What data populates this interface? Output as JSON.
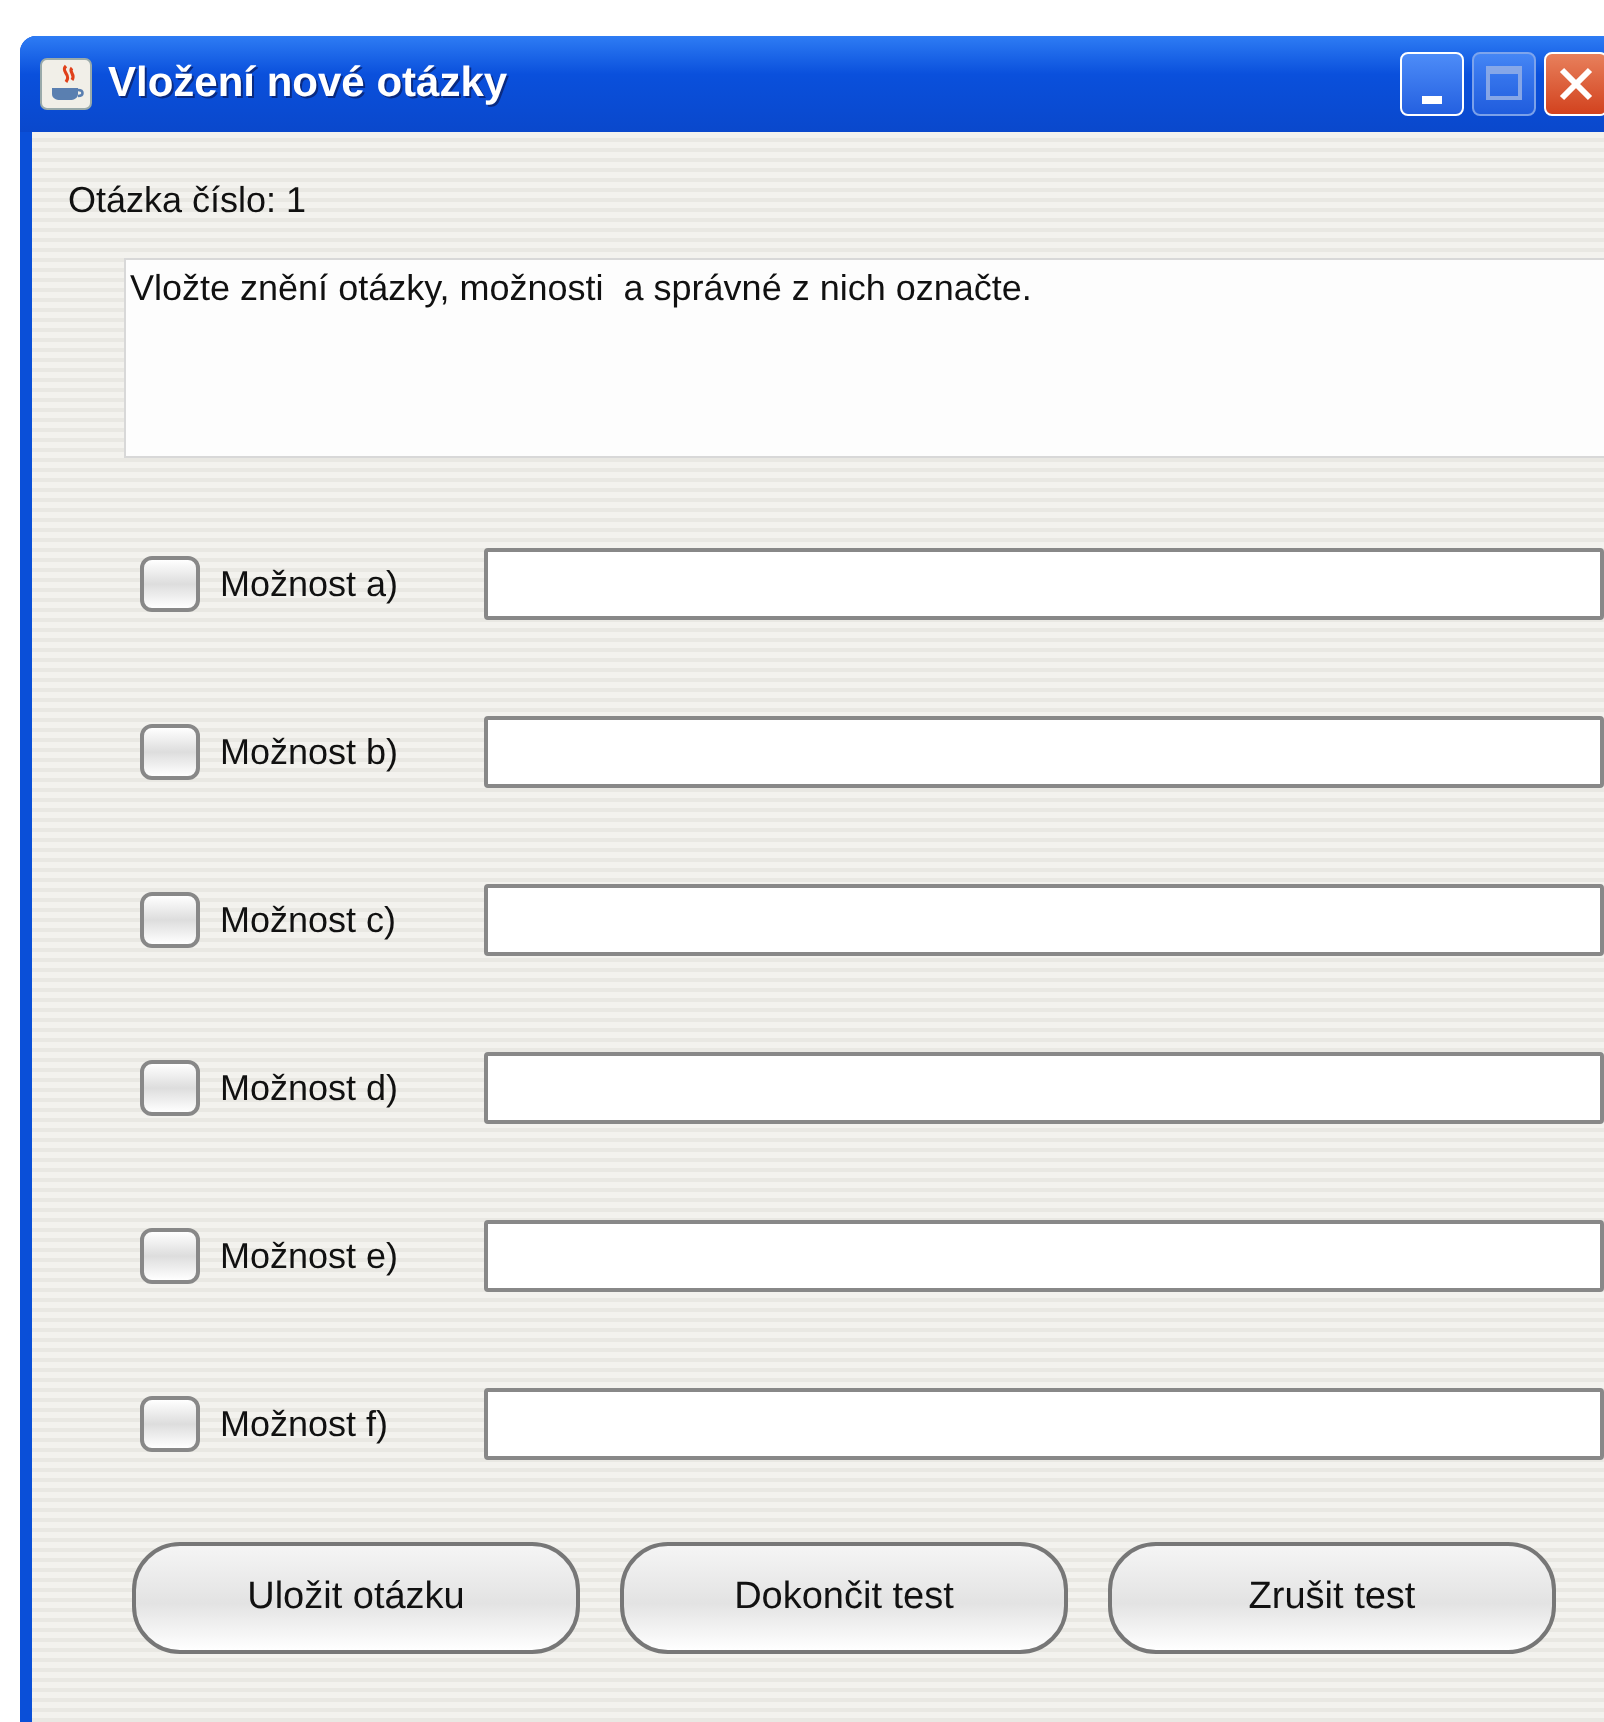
{
  "window": {
    "title": "Vložení nové otázky"
  },
  "question_number": "Otázka číslo: 1",
  "question_text": {
    "value": "Vložte znění otázky, možnosti  a správné z nich označte."
  },
  "options": [
    {
      "label": "Možnost a)",
      "checked": false
    },
    {
      "label": "Možnost b)",
      "checked": false
    },
    {
      "label": "Možnost c)",
      "checked": false
    },
    {
      "label": "Možnost d)",
      "checked": false
    },
    {
      "label": "Možnost e)",
      "checked": false
    },
    {
      "label": "Možnost f)",
      "checked": false
    }
  ],
  "buttons": [
    "Uložit otázku",
    "Dokončit test",
    "Zrušit test"
  ]
}
